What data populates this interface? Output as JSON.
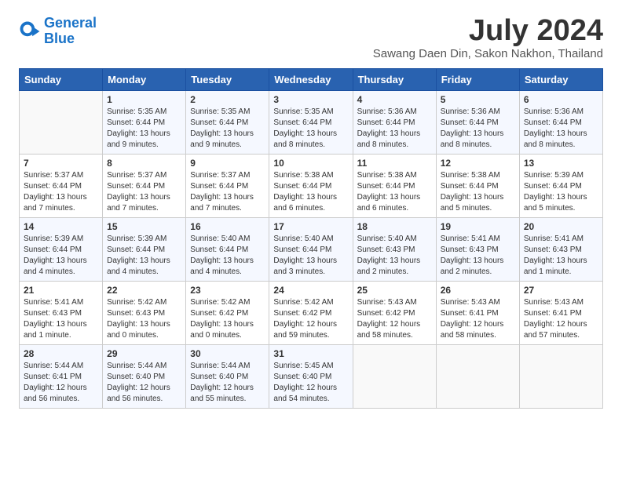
{
  "app": {
    "name": "GeneralBlue",
    "logo_text_1": "General",
    "logo_text_2": "Blue"
  },
  "calendar": {
    "month_year": "July 2024",
    "location": "Sawang Daen Din, Sakon Nakhon, Thailand",
    "days_of_week": [
      "Sunday",
      "Monday",
      "Tuesday",
      "Wednesday",
      "Thursday",
      "Friday",
      "Saturday"
    ],
    "weeks": [
      [
        {
          "num": "",
          "info": ""
        },
        {
          "num": "1",
          "info": "Sunrise: 5:35 AM\nSunset: 6:44 PM\nDaylight: 13 hours\nand 9 minutes."
        },
        {
          "num": "2",
          "info": "Sunrise: 5:35 AM\nSunset: 6:44 PM\nDaylight: 13 hours\nand 9 minutes."
        },
        {
          "num": "3",
          "info": "Sunrise: 5:35 AM\nSunset: 6:44 PM\nDaylight: 13 hours\nand 8 minutes."
        },
        {
          "num": "4",
          "info": "Sunrise: 5:36 AM\nSunset: 6:44 PM\nDaylight: 13 hours\nand 8 minutes."
        },
        {
          "num": "5",
          "info": "Sunrise: 5:36 AM\nSunset: 6:44 PM\nDaylight: 13 hours\nand 8 minutes."
        },
        {
          "num": "6",
          "info": "Sunrise: 5:36 AM\nSunset: 6:44 PM\nDaylight: 13 hours\nand 8 minutes."
        }
      ],
      [
        {
          "num": "7",
          "info": "Sunrise: 5:37 AM\nSunset: 6:44 PM\nDaylight: 13 hours\nand 7 minutes."
        },
        {
          "num": "8",
          "info": "Sunrise: 5:37 AM\nSunset: 6:44 PM\nDaylight: 13 hours\nand 7 minutes."
        },
        {
          "num": "9",
          "info": "Sunrise: 5:37 AM\nSunset: 6:44 PM\nDaylight: 13 hours\nand 7 minutes."
        },
        {
          "num": "10",
          "info": "Sunrise: 5:38 AM\nSunset: 6:44 PM\nDaylight: 13 hours\nand 6 minutes."
        },
        {
          "num": "11",
          "info": "Sunrise: 5:38 AM\nSunset: 6:44 PM\nDaylight: 13 hours\nand 6 minutes."
        },
        {
          "num": "12",
          "info": "Sunrise: 5:38 AM\nSunset: 6:44 PM\nDaylight: 13 hours\nand 5 minutes."
        },
        {
          "num": "13",
          "info": "Sunrise: 5:39 AM\nSunset: 6:44 PM\nDaylight: 13 hours\nand 5 minutes."
        }
      ],
      [
        {
          "num": "14",
          "info": "Sunrise: 5:39 AM\nSunset: 6:44 PM\nDaylight: 13 hours\nand 4 minutes."
        },
        {
          "num": "15",
          "info": "Sunrise: 5:39 AM\nSunset: 6:44 PM\nDaylight: 13 hours\nand 4 minutes."
        },
        {
          "num": "16",
          "info": "Sunrise: 5:40 AM\nSunset: 6:44 PM\nDaylight: 13 hours\nand 4 minutes."
        },
        {
          "num": "17",
          "info": "Sunrise: 5:40 AM\nSunset: 6:44 PM\nDaylight: 13 hours\nand 3 minutes."
        },
        {
          "num": "18",
          "info": "Sunrise: 5:40 AM\nSunset: 6:43 PM\nDaylight: 13 hours\nand 2 minutes."
        },
        {
          "num": "19",
          "info": "Sunrise: 5:41 AM\nSunset: 6:43 PM\nDaylight: 13 hours\nand 2 minutes."
        },
        {
          "num": "20",
          "info": "Sunrise: 5:41 AM\nSunset: 6:43 PM\nDaylight: 13 hours\nand 1 minute."
        }
      ],
      [
        {
          "num": "21",
          "info": "Sunrise: 5:41 AM\nSunset: 6:43 PM\nDaylight: 13 hours\nand 1 minute."
        },
        {
          "num": "22",
          "info": "Sunrise: 5:42 AM\nSunset: 6:43 PM\nDaylight: 13 hours\nand 0 minutes."
        },
        {
          "num": "23",
          "info": "Sunrise: 5:42 AM\nSunset: 6:42 PM\nDaylight: 13 hours\nand 0 minutes."
        },
        {
          "num": "24",
          "info": "Sunrise: 5:42 AM\nSunset: 6:42 PM\nDaylight: 12 hours\nand 59 minutes."
        },
        {
          "num": "25",
          "info": "Sunrise: 5:43 AM\nSunset: 6:42 PM\nDaylight: 12 hours\nand 58 minutes."
        },
        {
          "num": "26",
          "info": "Sunrise: 5:43 AM\nSunset: 6:41 PM\nDaylight: 12 hours\nand 58 minutes."
        },
        {
          "num": "27",
          "info": "Sunrise: 5:43 AM\nSunset: 6:41 PM\nDaylight: 12 hours\nand 57 minutes."
        }
      ],
      [
        {
          "num": "28",
          "info": "Sunrise: 5:44 AM\nSunset: 6:41 PM\nDaylight: 12 hours\nand 56 minutes."
        },
        {
          "num": "29",
          "info": "Sunrise: 5:44 AM\nSunset: 6:40 PM\nDaylight: 12 hours\nand 56 minutes."
        },
        {
          "num": "30",
          "info": "Sunrise: 5:44 AM\nSunset: 6:40 PM\nDaylight: 12 hours\nand 55 minutes."
        },
        {
          "num": "31",
          "info": "Sunrise: 5:45 AM\nSunset: 6:40 PM\nDaylight: 12 hours\nand 54 minutes."
        },
        {
          "num": "",
          "info": ""
        },
        {
          "num": "",
          "info": ""
        },
        {
          "num": "",
          "info": ""
        }
      ]
    ]
  }
}
